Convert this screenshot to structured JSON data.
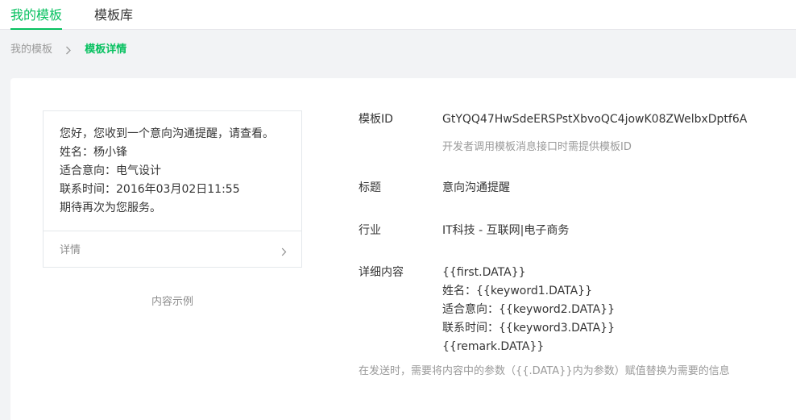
{
  "tabs": [
    {
      "label": "我的模板",
      "active": true
    },
    {
      "label": "模板库",
      "active": false
    }
  ],
  "breadcrumb": {
    "home": "我的模板",
    "current": "模板详情"
  },
  "preview": {
    "lines": [
      "您好，您收到一个意向沟通提醒，请查看。",
      "姓名：杨小锋",
      "适合意向：电气设计",
      "联系时间：2016年03月02日11:55",
      "期待再次为您服务。"
    ],
    "detail_label": "详情",
    "caption": "内容示例"
  },
  "details": {
    "template_id_label": "模板ID",
    "template_id": "GtYQQ47HwSdeERSPstXbvoQC4jowK08ZWelbxDptf6A",
    "template_id_hint": "开发者调用模板消息接口时需提供模板ID",
    "title_label": "标题",
    "title": "意向沟通提醒",
    "industry_label": "行业",
    "industry": "IT科技 - 互联网|电子商务",
    "content_label": "详细内容",
    "content_lines": [
      "{{first.DATA}}",
      "姓名：{{keyword1.DATA}}",
      "适合意向：{{keyword2.DATA}}",
      "联系时间：{{keyword3.DATA}}",
      "{{remark.DATA}}"
    ],
    "footnote": "在发送时，需要将内容中的参数（{{.DATA}}内为参数）赋值替换为需要的信息"
  },
  "colors": {
    "accent": "#07c160",
    "background": "#f2f3f5",
    "muted": "#9a9a9a"
  },
  "icons": {
    "breadcrumb_separator": "chevron-right-icon",
    "detail_arrow": "chevron-right-icon"
  }
}
